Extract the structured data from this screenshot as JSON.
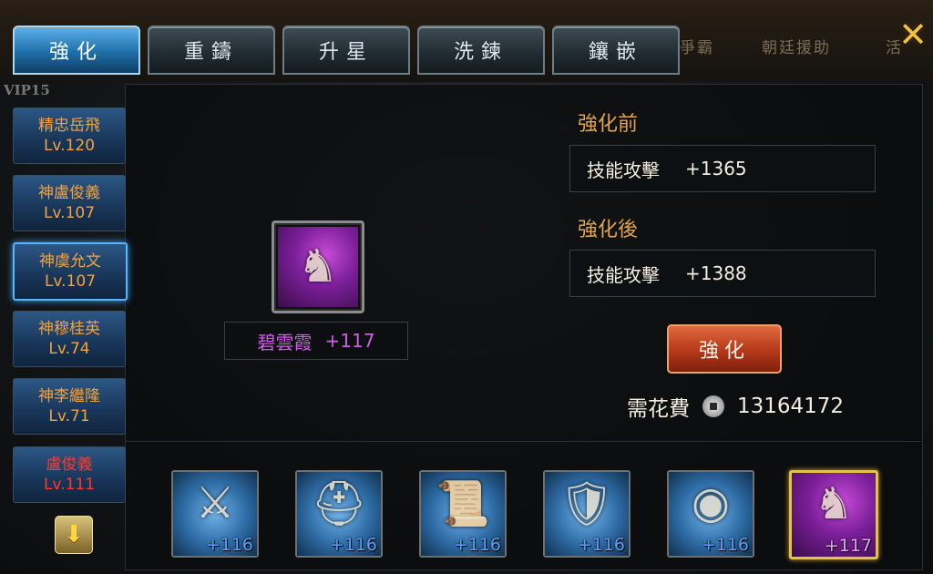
{
  "tabs": [
    {
      "label": "強化"
    },
    {
      "label": "重鑄"
    },
    {
      "label": "升星"
    },
    {
      "label": "洗鍊"
    },
    {
      "label": "鑲嵌"
    }
  ],
  "background_labels": [
    "爭霸",
    "朝廷援助",
    "活"
  ],
  "vip_label": "VIP15",
  "close_icon": "close-x-icon",
  "heroes": [
    {
      "name": "精忠岳飛",
      "level": "Lv.120",
      "color": "#f3a23c"
    },
    {
      "name": "神盧俊義",
      "level": "Lv.107",
      "color": "#f3a23c"
    },
    {
      "name": "神虞允文",
      "level": "Lv.107",
      "color": "#f3a23c"
    },
    {
      "name": "神穆桂英",
      "level": "Lv.74",
      "color": "#f3a23c"
    },
    {
      "name": "神李繼隆",
      "level": "Lv.71",
      "color": "#f3a23c"
    },
    {
      "name": "盧俊義",
      "level": "Lv.111",
      "color": "#ff3a2e"
    }
  ],
  "selected_item": {
    "name": "碧雲霞",
    "level": "+117",
    "icon": "horse-icon"
  },
  "before": {
    "title": "強化前",
    "stat_name": "技能攻擊",
    "stat_value": "+1365"
  },
  "after": {
    "title": "強化後",
    "stat_name": "技能攻擊",
    "stat_value": "+1388"
  },
  "enhance_button": "強化",
  "cost": {
    "label": "需花費",
    "amount": "13164172",
    "icon": "coin-icon"
  },
  "equipment": [
    {
      "icon": "sword-icon",
      "level": "+116"
    },
    {
      "icon": "helmet-icon",
      "level": "+116"
    },
    {
      "icon": "scroll-icon",
      "level": "+116"
    },
    {
      "icon": "armor-icon",
      "level": "+116"
    },
    {
      "icon": "shield-icon",
      "level": "+116"
    },
    {
      "icon": "horse-icon",
      "level": "+117"
    }
  ],
  "colors": {
    "accent_orange": "#e2a54b",
    "purple_item": "#d35ce8",
    "level_blue": "#5aa0ff"
  }
}
